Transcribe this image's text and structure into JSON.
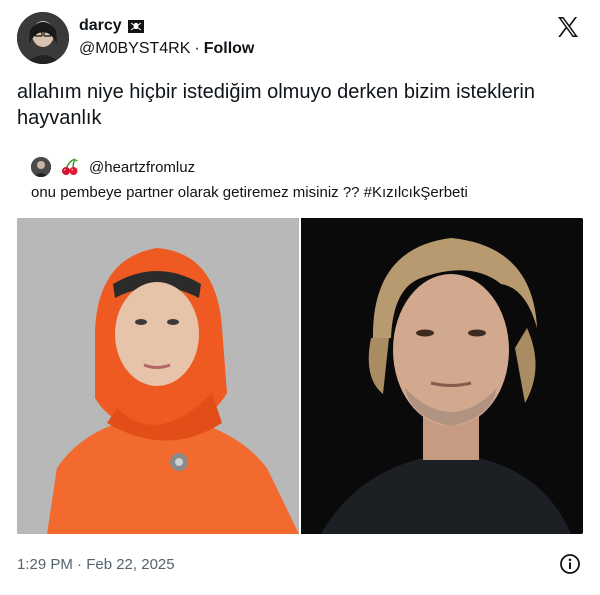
{
  "author": {
    "display_name": "darcy",
    "handle": "@M0BYST4RK",
    "separator": "·",
    "follow_label": "Follow",
    "name_badge_icon": "pirate-flag-icon"
  },
  "brand_icon": "x-logo-icon",
  "tweet": {
    "text": "allahım niye hiçbir istediğim olmuyo derken bizim isteklerin hayvanlık"
  },
  "quoted": {
    "emoji_icon": "cherry-icon",
    "handle": "@heartzfromluz",
    "text": "onu pembeye partner olarak getiremez misiniz ?? #KızılcıkŞerbeti"
  },
  "photos": [
    {
      "name": "woman-orange-hijab-photo"
    },
    {
      "name": "man-blond-hair-photo"
    }
  ],
  "footer": {
    "timestamp": "1:29 PM · Feb 22, 2025",
    "info_icon": "info-icon"
  },
  "colors": {
    "text": "#0f1419",
    "muted": "#536471",
    "orange": "#ff5a1f"
  }
}
